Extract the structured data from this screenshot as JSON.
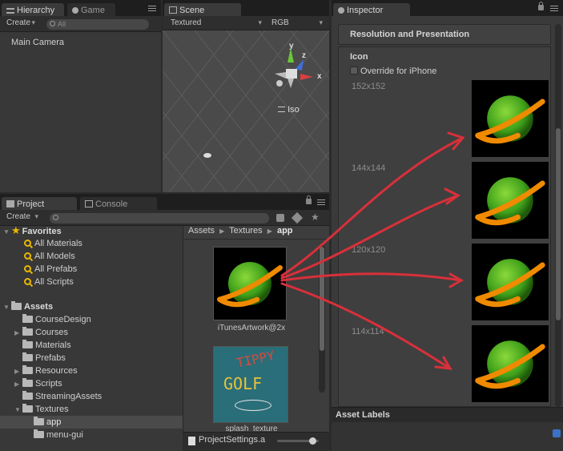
{
  "hierarchy": {
    "tab_label": "Hierarchy",
    "game_tab_label": "Game",
    "create_label": "Create",
    "search_placeholder": "All",
    "items": [
      "Main Camera"
    ]
  },
  "scene": {
    "tab_label": "Scene",
    "shading_mode": "Textured",
    "color_mode": "RGB",
    "gizmo_labels": {
      "y": "y",
      "z": "z",
      "x": "x"
    },
    "projection_label": "Iso"
  },
  "project": {
    "tab_label": "Project",
    "console_tab_label": "Console",
    "create_label": "Create",
    "favorites": {
      "label": "Favorites",
      "items": [
        "All Materials",
        "All Models",
        "All Prefabs",
        "All Scripts"
      ]
    },
    "assets": {
      "label": "Assets",
      "folders": [
        {
          "name": "CourseDesign",
          "expandable": false
        },
        {
          "name": "Courses",
          "expandable": true
        },
        {
          "name": "Materials",
          "expandable": false
        },
        {
          "name": "Prefabs",
          "expandable": false
        },
        {
          "name": "Resources",
          "expandable": true
        },
        {
          "name": "Scripts",
          "expandable": true
        },
        {
          "name": "StreamingAssets",
          "expandable": false
        },
        {
          "name": "Textures",
          "expandable": true,
          "expanded": true
        }
      ],
      "textures_children": [
        "app",
        "menu-gui"
      ]
    },
    "breadcrumb": [
      "Assets",
      "Textures",
      "app"
    ],
    "thumbnails": [
      {
        "label": "iTunesArtwork@2x"
      },
      {
        "label": "splash_texture",
        "art_text_1": "TIPPY",
        "art_text_2": "GOLF"
      }
    ],
    "status_file": "ProjectSettings.a"
  },
  "inspector": {
    "tab_label": "Inspector",
    "section_title": "Resolution and Presentation",
    "icon_heading": "Icon",
    "override_label": "Override for iPhone",
    "override_checked": false,
    "sizes": [
      "152x152",
      "144x144",
      "120x120",
      "114x114"
    ],
    "asset_labels_title": "Asset Labels"
  },
  "colors": {
    "planet_green": "#3fa01a",
    "ring_orange": "#f08a00",
    "annotation_red": "#d8303a",
    "favorites_yellow": "#e8b800",
    "selection_gray": "#4a4a4a"
  }
}
